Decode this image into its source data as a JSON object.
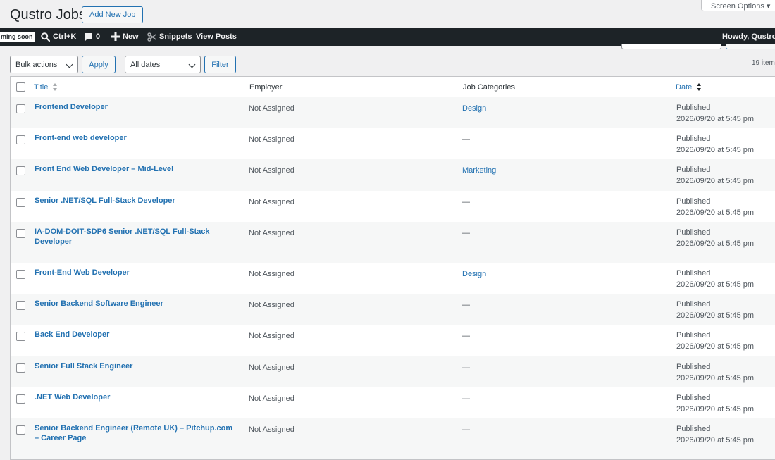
{
  "header": {
    "title": "Qustro Jobs",
    "add_new": "Add New Job",
    "screen_options": "Screen Options ▾"
  },
  "adminbar": {
    "coming_soon": "ming soon",
    "search_shortcut": "Ctrl+K",
    "comments_count": "0",
    "new": "New",
    "snippets": "Snippets",
    "view_posts": "View Posts",
    "howdy": "Howdy, Qustro"
  },
  "tablenav": {
    "bulk_actions": "Bulk actions",
    "apply": "Apply",
    "all_dates": "All dates",
    "filter": "Filter",
    "items_count": "19 items"
  },
  "columns": {
    "title": "Title",
    "employer": "Employer",
    "categories": "Job Categories",
    "date": "Date"
  },
  "rows": [
    {
      "title": "Frontend Developer",
      "employer": "Not Assigned",
      "category": "Design",
      "status": "Published",
      "date": "2026/09/20 at 5:45 pm"
    },
    {
      "title": "Front-end web developer",
      "employer": "Not Assigned",
      "category": "—",
      "status": "Published",
      "date": "2026/09/20 at 5:45 pm"
    },
    {
      "title": "Front End Web Developer – Mid-Level",
      "employer": "Not Assigned",
      "category": "Marketing",
      "status": "Published",
      "date": "2026/09/20 at 5:45 pm"
    },
    {
      "title": "Senior .NET/SQL Full-Stack Developer",
      "employer": "Not Assigned",
      "category": "—",
      "status": "Published",
      "date": "2026/09/20 at 5:45 pm"
    },
    {
      "title": "IA-DOM-DOIT-SDP6 Senior .NET/SQL Full-Stack Developer",
      "employer": "Not Assigned",
      "category": "—",
      "status": "Published",
      "date": "2026/09/20 at 5:45 pm"
    },
    {
      "title": "Front-End Web Developer",
      "employer": "Not Assigned",
      "category": "Design",
      "status": "Published",
      "date": "2026/09/20 at 5:45 pm"
    },
    {
      "title": "Senior Backend Software Engineer",
      "employer": "Not Assigned",
      "category": "—",
      "status": "Published",
      "date": "2026/09/20 at 5:45 pm"
    },
    {
      "title": "Back End Developer",
      "employer": "Not Assigned",
      "category": "—",
      "status": "Published",
      "date": "2026/09/20 at 5:45 pm"
    },
    {
      "title": "Senior Full Stack Engineer",
      "employer": "Not Assigned",
      "category": "—",
      "status": "Published",
      "date": "2026/09/20 at 5:45 pm"
    },
    {
      "title": ".NET Web Developer",
      "employer": "Not Assigned",
      "category": "—",
      "status": "Published",
      "date": "2026/09/20 at 5:45 pm"
    },
    {
      "title": "Senior Backend Engineer (Remote UK) – Pitchup.com – Career Page",
      "employer": "Not Assigned",
      "category": "—",
      "status": "Published",
      "date": "2026/09/20 at 5:45 pm"
    }
  ],
  "colors": {
    "link": "#2271b1",
    "adminbar_bg": "#1d2327",
    "page_bg": "#f0f0f1"
  }
}
